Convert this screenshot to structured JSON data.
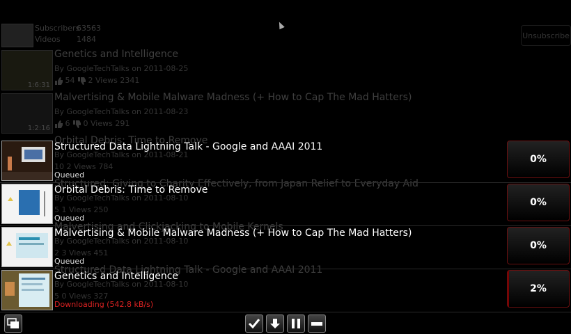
{
  "subscription": {
    "subscribers_label": "Subscribers",
    "subscribers_value": "63563",
    "videos_label": "Videos",
    "videos_value": "1484",
    "unsubscribe_label": "Unsubscribe"
  },
  "background_videos": [
    {
      "title": "Genetics and Intelligence",
      "byline": "By GoogleTechTalks on 2011-08-25",
      "duration": "1:6:31",
      "likes": "54",
      "dislikes": "2",
      "views_label": "Views",
      "views": "2341"
    },
    {
      "title": "Malvertising & Mobile Malware Madness (+ How to Cap The Mad Hatters)",
      "byline": "By GoogleTechTalks on 2011-08-23",
      "duration": "1:2:16",
      "likes": "6",
      "dislikes": "0",
      "views_label": "Views",
      "views": "291"
    },
    {
      "title": "Orbital Debris: Time to Remove",
      "byline": "By GoogleTechTalks on 2011-08-21",
      "duration": "",
      "likes": "10",
      "dislikes": "2",
      "views_label": "Views",
      "views": "784"
    },
    {
      "title": "Structured: Giving to Charity Effectively, from Japan Relief to Everyday Aid",
      "byline": "By GoogleTechTalks on 2011-08-10",
      "duration": "",
      "likes": "5",
      "dislikes": "1",
      "views_label": "Views",
      "views": "250"
    },
    {
      "title": "Malvertising and Clickjacking to Mobile Kernels",
      "byline": "By GoogleTechTalks on 2011-08-10",
      "duration": "",
      "likes": "2",
      "dislikes": "3",
      "views_label": "Views",
      "views": "451"
    },
    {
      "title": "Structured Data Lightning Talk - Google and AAAI 2011",
      "byline": "By GoogleTechTalks on 2011-08-10",
      "duration": "",
      "likes": "5",
      "dislikes": "0",
      "views_label": "Views",
      "views": "327"
    }
  ],
  "downloads": [
    {
      "title": "Structured Data Lightning Talk - Google and AAAI 2011",
      "status": "Queued",
      "percent_label": "0%",
      "progress": 0
    },
    {
      "title": "Orbital Debris: Time to Remove",
      "status": "Queued",
      "percent_label": "0%",
      "progress": 0
    },
    {
      "title": "Malvertising & Mobile Malware Madness (+ How to Cap The Mad Hatters)",
      "status": "Queued",
      "percent_label": "0%",
      "progress": 0
    },
    {
      "title": "Genetics and Intelligence",
      "status": "Downloading (542.8 kB/s)",
      "percent_label": "2%",
      "progress": 0.02
    }
  ],
  "toolbar": {
    "icons": [
      "windows-icon",
      "check-icon",
      "download-icon",
      "pause-icon",
      "remove-icon"
    ]
  },
  "colors": {
    "accent_red": "#d22222",
    "button_border": "#6a1010"
  }
}
